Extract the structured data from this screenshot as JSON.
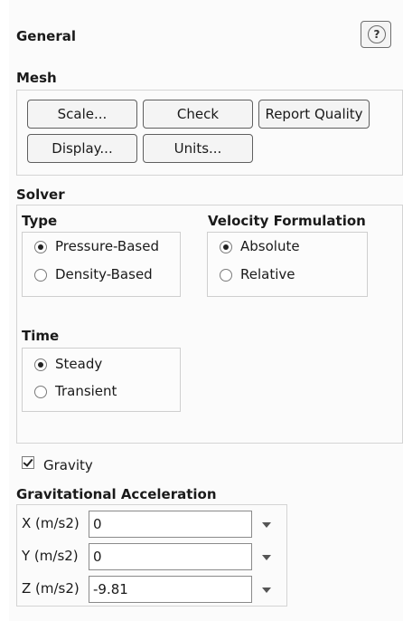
{
  "panel": {
    "title": "General"
  },
  "mesh": {
    "label": "Mesh",
    "buttons": [
      "Scale...",
      "Check",
      "Report Quality",
      "Display...",
      "Units..."
    ]
  },
  "solver": {
    "label": "Solver",
    "type": {
      "label": "Type",
      "options": [
        "Pressure-Based",
        "Density-Based"
      ],
      "selected": "Pressure-Based"
    },
    "velocity": {
      "label": "Velocity Formulation",
      "options": [
        "Absolute",
        "Relative"
      ],
      "selected": "Absolute"
    },
    "time": {
      "label": "Time",
      "options": [
        "Steady",
        "Transient"
      ],
      "selected": "Steady"
    }
  },
  "gravity": {
    "label": "Gravity",
    "checked": true
  },
  "grav_accel": {
    "label": "Gravitational Acceleration",
    "fields": [
      {
        "label": "X (m/s2)",
        "value": "0"
      },
      {
        "label": "Y (m/s2)",
        "value": "0"
      },
      {
        "label": "Z (m/s2)",
        "value": "-9.81"
      }
    ]
  },
  "icons": {
    "help": "help-icon",
    "dropdown": "chevron-down-icon"
  }
}
